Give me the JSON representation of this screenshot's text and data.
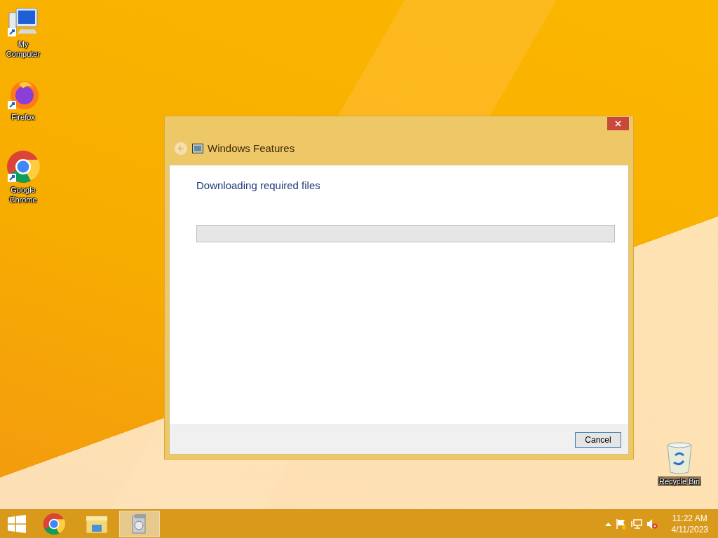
{
  "desktop_icons": [
    {
      "kind": "computer",
      "label": "My Computer"
    },
    {
      "kind": "firefox",
      "label": "Firefox"
    },
    {
      "kind": "chrome",
      "label": "Google Chrome"
    },
    {
      "kind": "recycle",
      "label": "Recycle Bin"
    }
  ],
  "window": {
    "title": "Windows Features",
    "heading": "Downloading required files",
    "progress": {
      "level": 0
    },
    "buttons": [
      "Cancel"
    ]
  },
  "taskbar": {
    "items": [
      {
        "kind": "chrome",
        "selected": false
      },
      {
        "kind": "explorer",
        "selected": false
      },
      {
        "kind": "features",
        "selected": true
      }
    ]
  },
  "tray": {
    "time": "11:22 AM",
    "date": "4/11/2023"
  }
}
